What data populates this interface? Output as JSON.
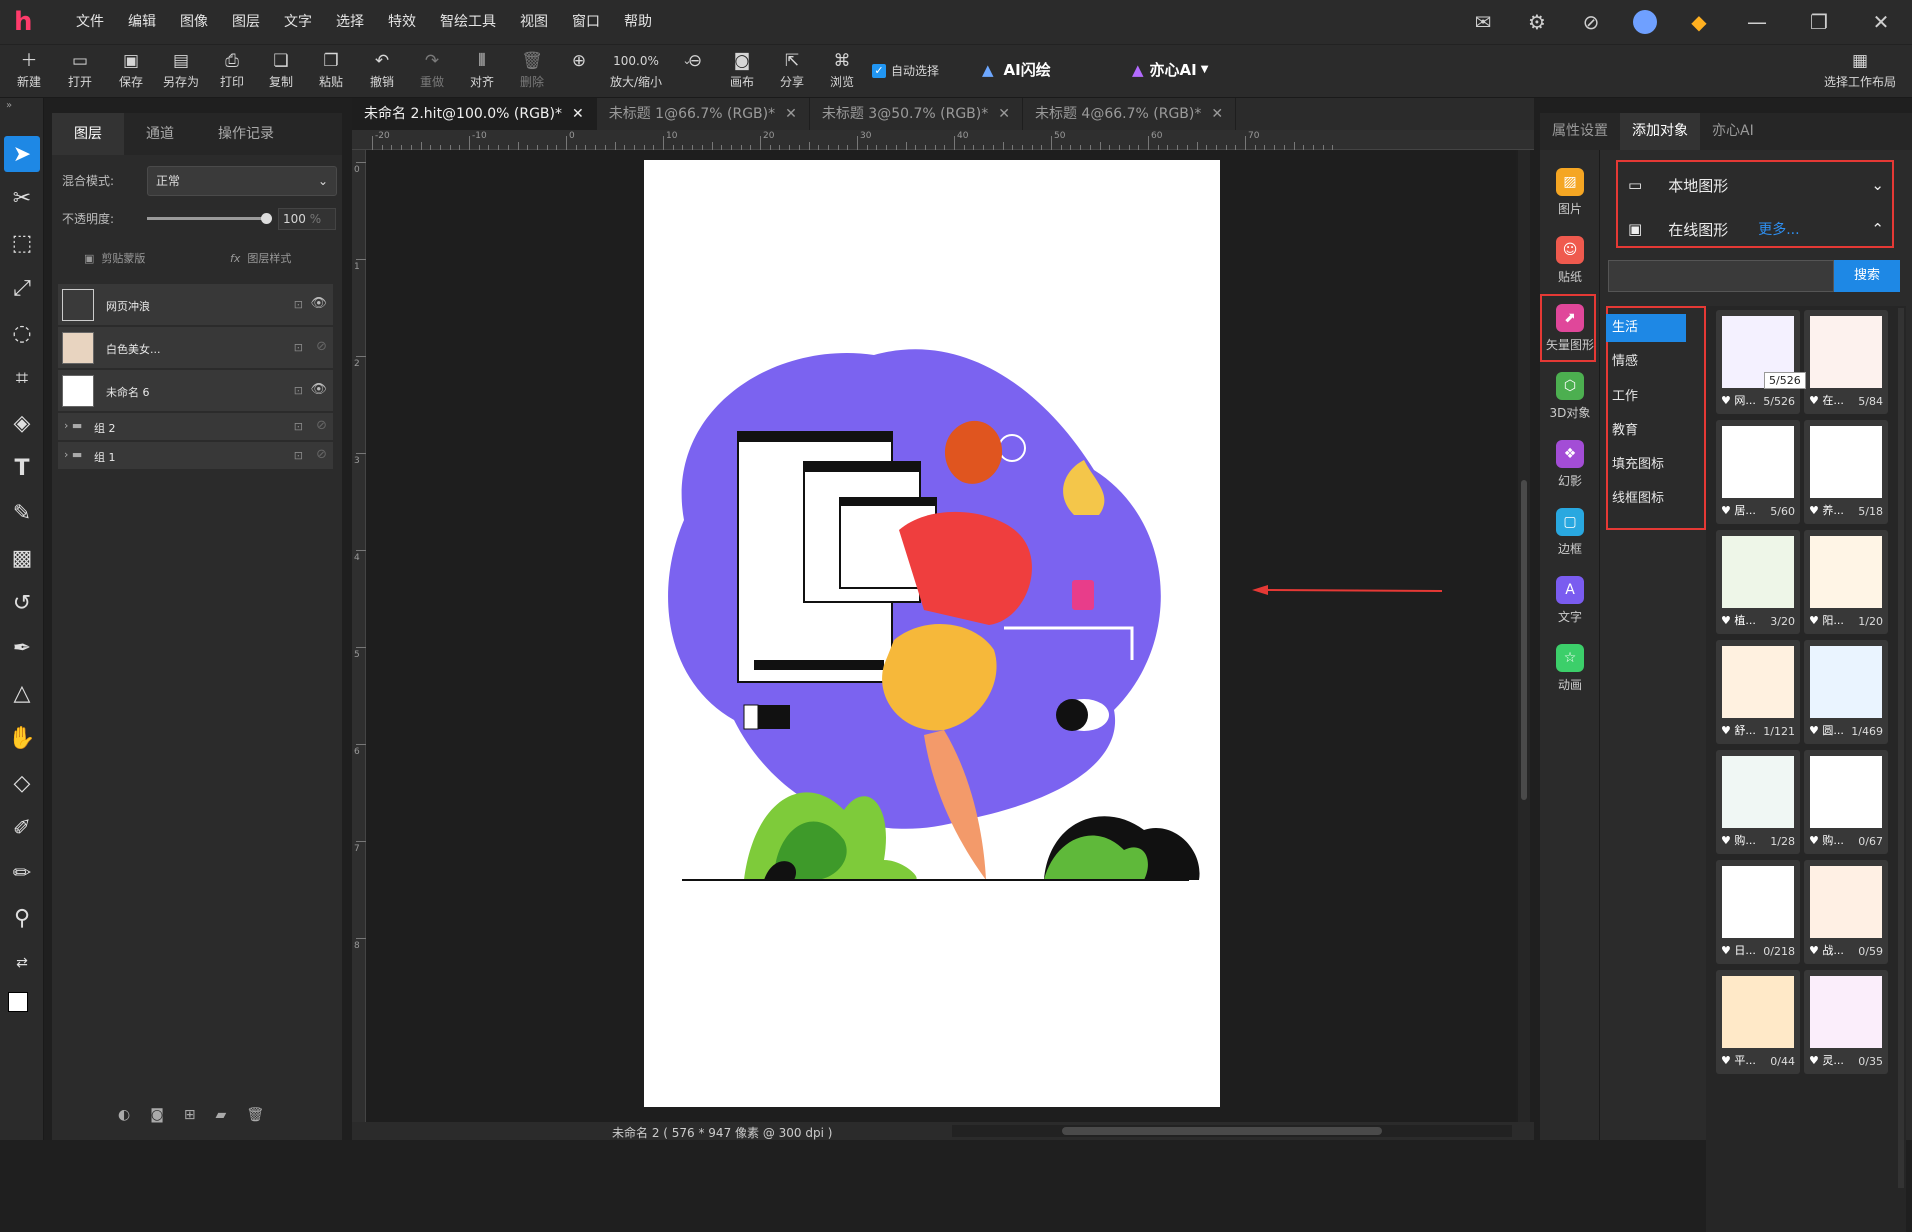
{
  "app": {
    "logo": "h"
  },
  "menubar": [
    "文件",
    "编辑",
    "图像",
    "图层",
    "文字",
    "选择",
    "特效",
    "智绘工具",
    "视图",
    "窗口",
    "帮助"
  ],
  "window_icons": [
    "mail-icon",
    "settings-icon",
    "compass-icon",
    "avatar",
    "gem-icon",
    "minimize-icon",
    "restore-icon",
    "close-icon"
  ],
  "toolbar": {
    "new": "新建",
    "open": "打开",
    "save": "保存",
    "saveas": "另存为",
    "print": "打印",
    "copy": "复制",
    "paste": "粘贴",
    "undo": "撤销",
    "redo": "重做",
    "align": "对齐",
    "delete": "删除",
    "zoom_value": "100.0%",
    "zoom_label": "放大/缩小",
    "canvas": "画布",
    "share": "分享",
    "browse": "浏览",
    "auto_select": "自动选择",
    "ai_flash": "AI闪绘",
    "yixin_ai": "亦心AI",
    "workspace": "选择工作布局"
  },
  "layers_panel": {
    "tabs": [
      "图层",
      "通道",
      "操作记录"
    ],
    "blend_label": "混合模式:",
    "blend_value": "正常",
    "opacity_label": "不透明度:",
    "opacity_value": "100",
    "opacity_unit": "%",
    "opacity_fraction": 1.0,
    "clip_mask": "剪贴蒙版",
    "layer_style": "图层样式",
    "layers": [
      {
        "name": "网页冲浪",
        "visible": true
      },
      {
        "name": "白色美女...",
        "visible": false
      },
      {
        "name": "未命名 6",
        "visible": true
      },
      {
        "name": "组 2",
        "visible": false,
        "group": true
      },
      {
        "name": "组 1",
        "visible": false,
        "group": true
      }
    ]
  },
  "doc_tabs": [
    "未命名 2.hit@100.0% (RGB)*",
    "未标题 1@66.7% (RGB)*",
    "未标题 3@50.7% (RGB)*",
    "未标题 4@66.7% (RGB)*"
  ],
  "ruler_h": [
    "-20",
    "-10",
    "0",
    "10",
    "20",
    "30",
    "40",
    "50",
    "60",
    "70"
  ],
  "ruler_v": [
    "0",
    "1",
    "2",
    "3",
    "4",
    "5",
    "6",
    "7",
    "8"
  ],
  "status": "未命名 2 ( 576 * 947 像素 @ 300 dpi )",
  "right_tabs": [
    "属性设置",
    "添加对象",
    "亦心AI"
  ],
  "side_icons": [
    {
      "label": "图片",
      "color": "#f5a623"
    },
    {
      "label": "贴纸",
      "color": "#ef5a4e"
    },
    {
      "label": "矢量图形",
      "color": "#e0479a"
    },
    {
      "label": "3D对象",
      "color": "#4caf50"
    },
    {
      "label": "幻影",
      "color": "#a34dd6"
    },
    {
      "label": "边框",
      "color": "#29a8e0"
    },
    {
      "label": "文字",
      "color": "#7a5cf0"
    },
    {
      "label": "动画",
      "color": "#3ccf6a"
    }
  ],
  "assets": {
    "local": "本地图形",
    "online": "在线图形",
    "more": "更多...",
    "search_btn": "搜索",
    "search_placeholder": "",
    "categories": [
      "生活",
      "情感",
      "工作",
      "教育",
      "填充图标",
      "线框图标"
    ],
    "tooltip": "5/526",
    "cards": [
      {
        "name": "网...",
        "count": "5/526"
      },
      {
        "name": "在...",
        "count": "5/84"
      },
      {
        "name": "居...",
        "count": "5/60"
      },
      {
        "name": "养...",
        "count": "5/18"
      },
      {
        "name": "植...",
        "count": "3/20"
      },
      {
        "name": "阳...",
        "count": "1/20"
      },
      {
        "name": "舒...",
        "count": "1/121"
      },
      {
        "name": "圆...",
        "count": "1/469"
      },
      {
        "name": "购...",
        "count": "1/28"
      },
      {
        "name": "购...",
        "count": "0/67"
      },
      {
        "name": "日...",
        "count": "0/218"
      },
      {
        "name": "战...",
        "count": "0/59"
      },
      {
        "name": "平...",
        "count": "0/44"
      },
      {
        "name": "灵...",
        "count": "0/35"
      }
    ]
  }
}
